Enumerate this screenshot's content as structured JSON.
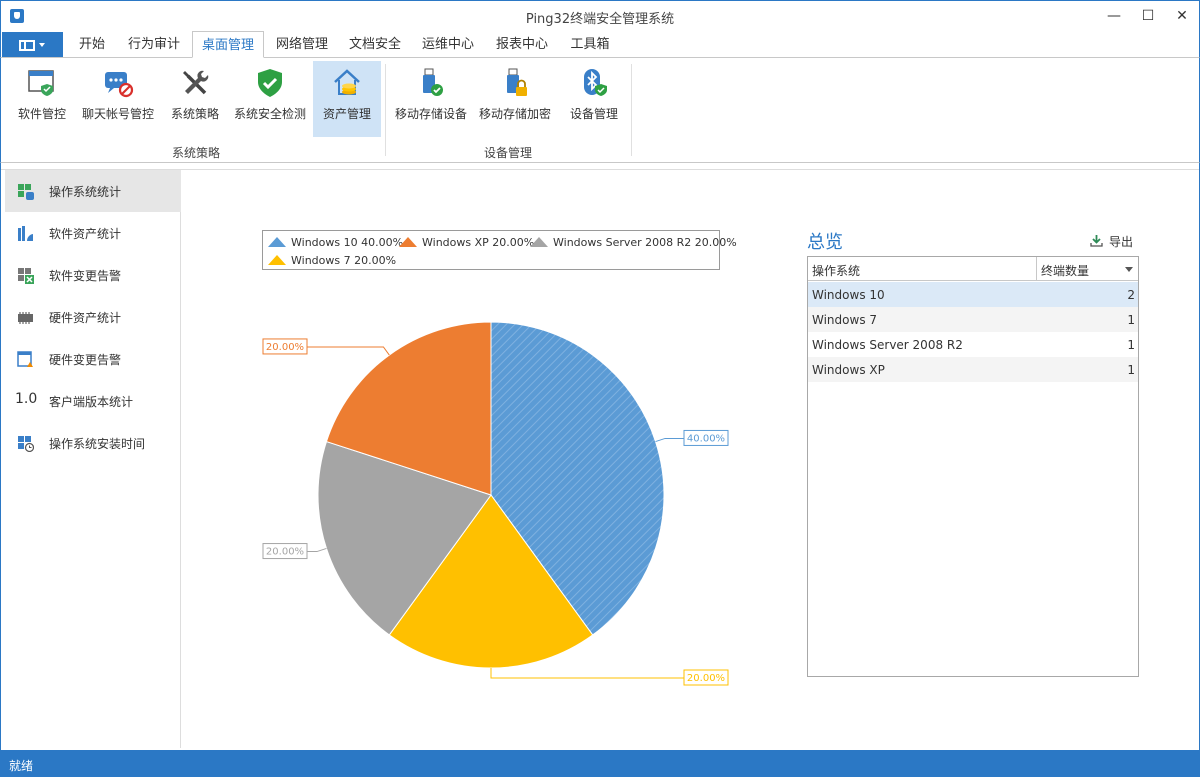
{
  "window": {
    "title": "Ping32终端安全管理系统",
    "minimize": "—",
    "maximize": "☐",
    "close": "✕"
  },
  "menu": {
    "tabs": [
      "开始",
      "行为审计",
      "桌面管理",
      "网络管理",
      "文档安全",
      "运维中心",
      "报表中心",
      "工具箱"
    ],
    "active": "桌面管理"
  },
  "ribbon": {
    "groups": [
      {
        "label": "系统策略",
        "items": [
          "软件管控",
          "聊天帐号管控",
          "系统策略",
          "系统安全检测",
          "资产管理"
        ]
      },
      {
        "label": "设备管理",
        "items": [
          "移动存储设备",
          "移动存储加密",
          "设备管理"
        ]
      }
    ],
    "active_item": "资产管理"
  },
  "sidebar": {
    "items": [
      "操作系统统计",
      "软件资产统计",
      "软件变更告警",
      "硬件资产统计",
      "硬件变更告警",
      "客户端版本统计",
      "操作系统安装时间"
    ],
    "version_icon_text": "1.0",
    "active": "操作系统统计"
  },
  "chart_data": {
    "type": "pie",
    "slices": [
      {
        "name": "Windows 10",
        "value": 40,
        "color": "#5b9bd5",
        "pattern": "hatched"
      },
      {
        "name": "Windows 7",
        "value": 20,
        "color": "#ffc000"
      },
      {
        "name": "Windows Server 2008 R2",
        "value": 20,
        "color": "#a5a5a5"
      },
      {
        "name": "Windows XP",
        "value": 20,
        "color": "#ed7d31"
      }
    ],
    "legend": [
      {
        "text": "Windows 10 40.00%",
        "color": "#5b9bd5"
      },
      {
        "text": "Windows XP 20.00%",
        "color": "#ed7d31"
      },
      {
        "text": "Windows Server 2008 R2 20.00%",
        "color": "#a5a5a5"
      },
      {
        "text": "Windows 7 20.00%",
        "color": "#ffc000"
      }
    ],
    "data_labels": [
      "40.00%",
      "20.00%",
      "20.00%",
      "20.00%"
    ],
    "legend_position": "top"
  },
  "overview": {
    "title": "总览",
    "export_label": "导出",
    "columns": [
      "操作系统",
      "终端数量"
    ],
    "rows": [
      {
        "os": "Windows 10",
        "count": "2"
      },
      {
        "os": "Windows 7",
        "count": "1"
      },
      {
        "os": "Windows Server 2008 R2",
        "count": "1"
      },
      {
        "os": "Windows XP",
        "count": "1"
      }
    ]
  },
  "status": {
    "text": "就绪"
  }
}
